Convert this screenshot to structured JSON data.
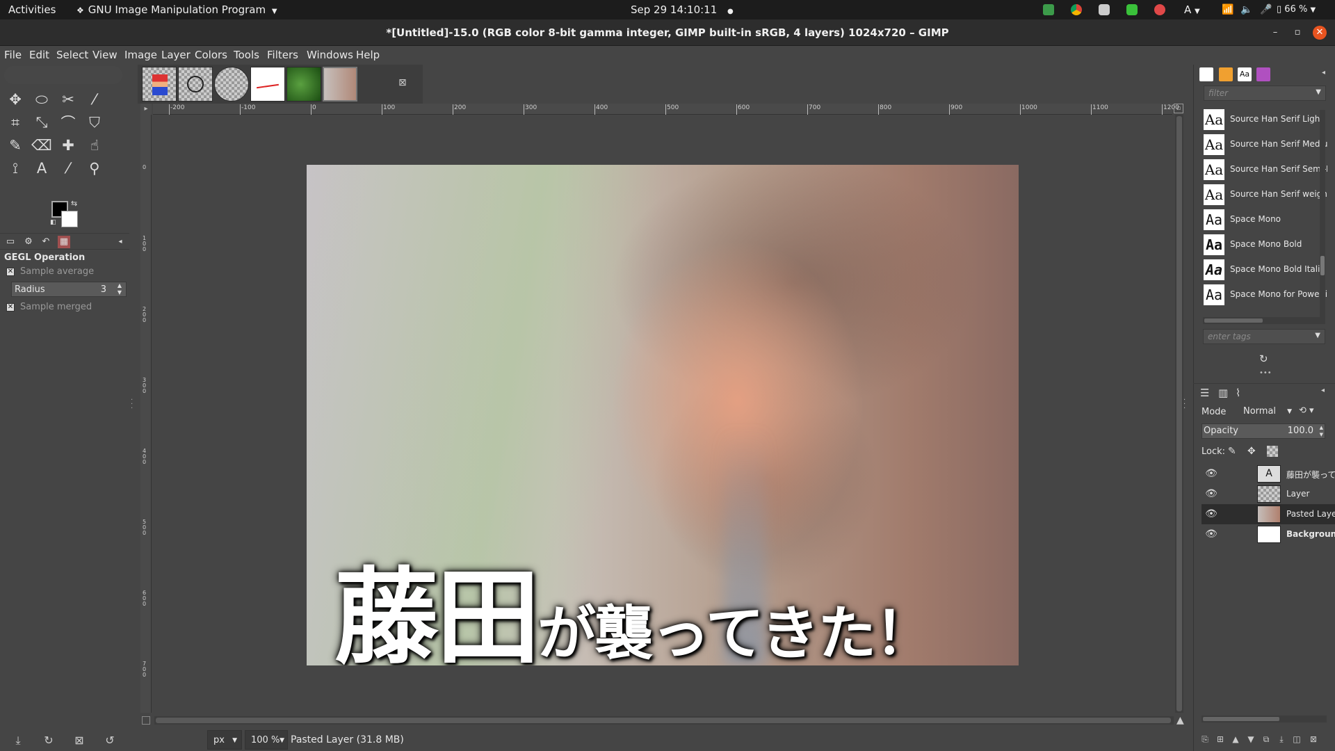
{
  "system_bar": {
    "activities": "Activities",
    "app_name": "GNU Image Manipulation Program",
    "datetime": "Sep 29  14:10:11",
    "input_method": "A",
    "battery": "66 %"
  },
  "window": {
    "title": "*[Untitled]-15.0 (RGB color 8-bit gamma integer, GIMP built-in sRGB, 4 layers) 1024x720 – GIMP"
  },
  "menu": [
    "File",
    "Edit",
    "Select",
    "View",
    "Image",
    "Layer",
    "Colors",
    "Tools",
    "Filters",
    "Windows",
    "Help"
  ],
  "tools": [
    {
      "name": "move-tool-icon",
      "glyph": "✥"
    },
    {
      "name": "ellipse-select-icon",
      "glyph": "⬭"
    },
    {
      "name": "scissors-select-icon",
      "glyph": "✂"
    },
    {
      "name": "fuzzy-select-icon",
      "glyph": "⁄"
    },
    {
      "name": "crop-tool-icon",
      "glyph": "⌗"
    },
    {
      "name": "scale-tool-icon",
      "glyph": "⤡"
    },
    {
      "name": "warp-transform-icon",
      "glyph": "⌒"
    },
    {
      "name": "bucket-fill-icon",
      "glyph": "⛉"
    },
    {
      "name": "paintbrush-icon",
      "glyph": "✎"
    },
    {
      "name": "eraser-icon",
      "glyph": "⌫"
    },
    {
      "name": "heal-tool-icon",
      "glyph": "✚"
    },
    {
      "name": "smudge-tool-icon",
      "glyph": "☝"
    },
    {
      "name": "paths-tool-icon",
      "glyph": "⟟"
    },
    {
      "name": "text-tool-icon",
      "glyph": "A"
    },
    {
      "name": "color-picker-icon",
      "glyph": "⁄"
    },
    {
      "name": "zoom-tool-icon",
      "glyph": "⚲"
    }
  ],
  "tool_options": {
    "title": "GEGL Operation",
    "sample_average": "Sample average",
    "radius_label": "Radius",
    "radius_value": "3",
    "sample_merged": "Sample merged"
  },
  "ruler": {
    "h_ticks": [
      "-200",
      "-100",
      "0",
      "100",
      "200",
      "300",
      "400",
      "500",
      "600",
      "700",
      "800",
      "900",
      "1000",
      "1100",
      "1200"
    ],
    "v_ticks": [
      "0",
      "1\n0\n0",
      "2\n0\n0",
      "3\n0\n0",
      "4\n0\n0",
      "5\n0\n0",
      "6\n0\n0",
      "7\n0\n0"
    ]
  },
  "image": {
    "caption_big": "藤田",
    "caption_small": "が襲ってきた！"
  },
  "status": {
    "unit": "px",
    "zoom": "100 %",
    "message": "Pasted Layer (31.8 MB)"
  },
  "fonts_panel": {
    "filter_placeholder": "filter",
    "tags_placeholder": "enter tags",
    "fonts": [
      "Source Han Serif Light",
      "Source Han Serif Medium",
      "Source Han Serif Semi-Bold",
      "Source Han Serif weight",
      "Space Mono",
      "Space Mono Bold",
      "Space Mono Bold Italic",
      "Space Mono for Powerline"
    ]
  },
  "layers_panel": {
    "mode_label": "Mode",
    "mode_value": "Normal",
    "opacity_label": "Opacity",
    "opacity_value": "100.0",
    "lock_label": "Lock:",
    "layers": [
      {
        "name": "藤田が襲ってきた",
        "selected": false
      },
      {
        "name": "Layer",
        "selected": false
      },
      {
        "name": "Pasted Layer",
        "selected": true
      },
      {
        "name": "Background",
        "selected": false
      }
    ]
  },
  "colors": {
    "accent_green": "#21a336",
    "fg_color": "#000000",
    "bg_color": "#ffffff"
  }
}
